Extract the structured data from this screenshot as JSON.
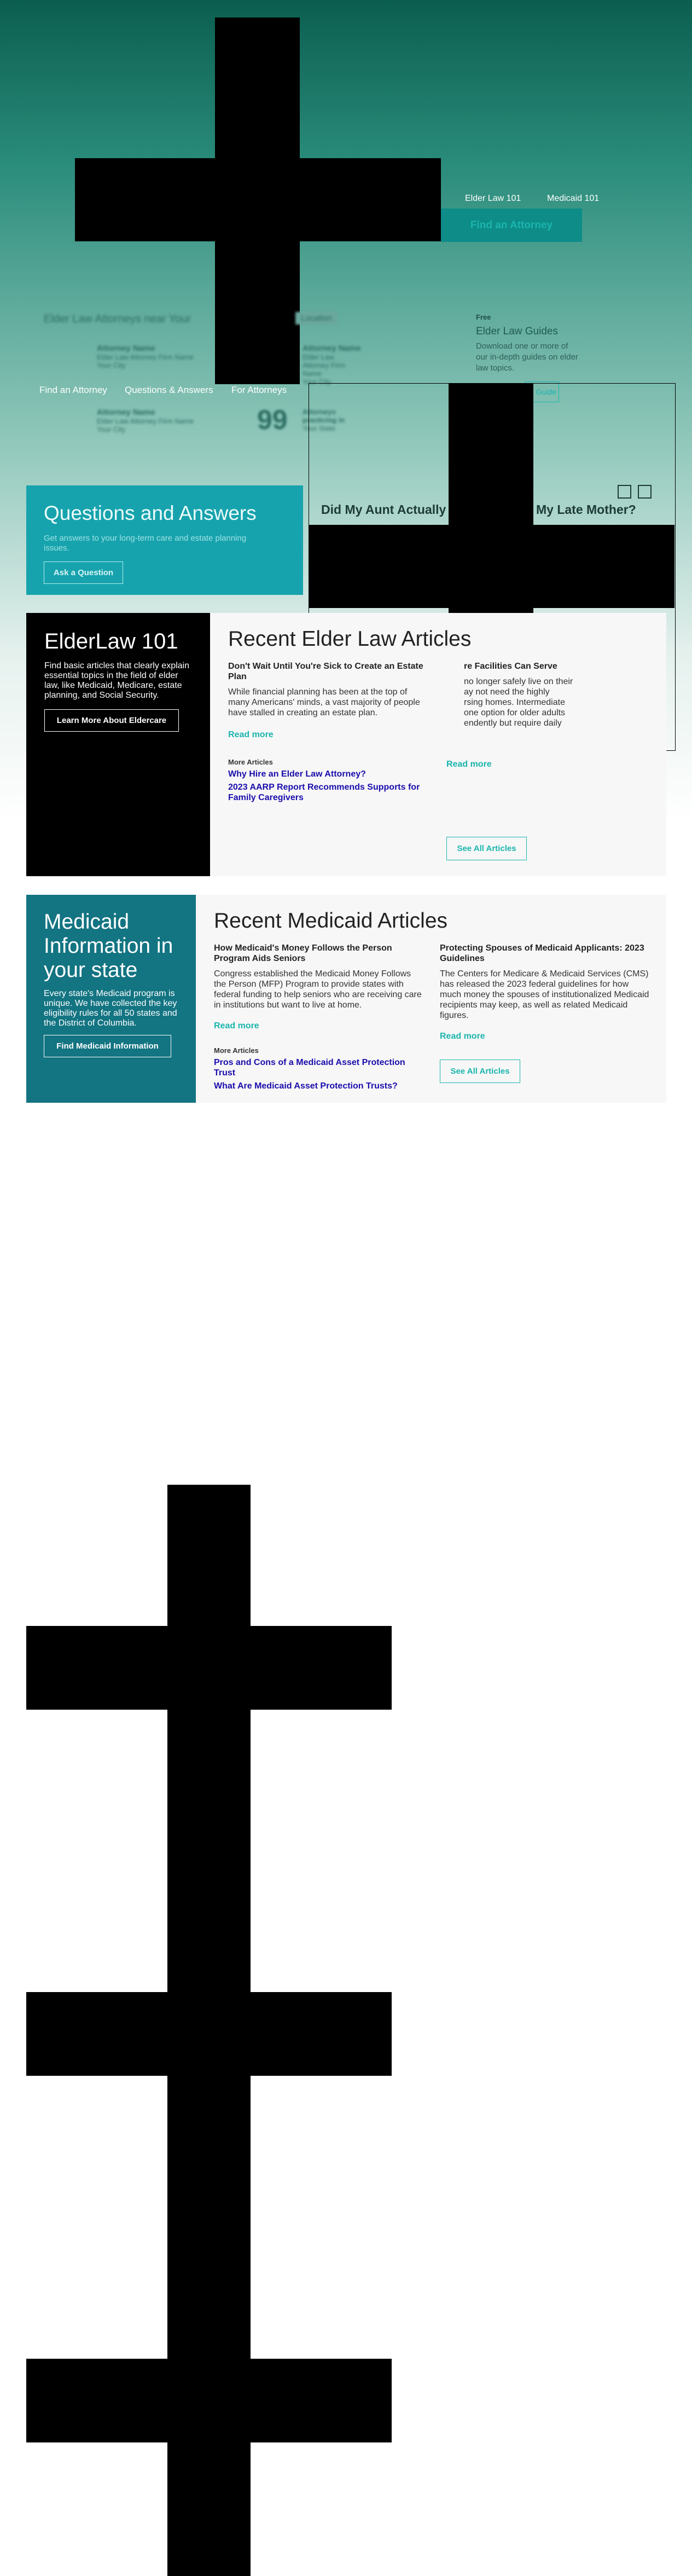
{
  "nav": {
    "elder_law_101": "Elder Law 101",
    "medicaid_101": "Medicaid 101",
    "find_attorney": "Find an Attorney"
  },
  "attorney_list": {
    "title": "Elder Law Attorneys near Your",
    "chip": "Location",
    "items": [
      {
        "name": "Attorney Name",
        "firm": "Elder Law Attorney Firm Name",
        "city": "Your City"
      },
      {
        "name": "Attorney Name",
        "firm": "Elder Law Attorney Firm Name",
        "city": "Your City"
      },
      {
        "name": "Attorney Name",
        "firm": "Elder Law Attorney Firm Name",
        "city": "Your City"
      }
    ],
    "count": "99",
    "count_label_1": "Attorneys practicing in",
    "count_label_2": "Your State"
  },
  "free_guides": {
    "label": "Free",
    "title": "Elder Law Guides",
    "desc_1": "Download one or more of",
    "desc_2": "our in-depth guides on elder",
    "desc_3": "law topics.",
    "button": "Guide"
  },
  "subnav": {
    "find_attorney": "Find an Attorney",
    "qa": "Questions & Answers",
    "for_attorneys": "For Attorneys"
  },
  "qa": {
    "title": "Questions and Answers",
    "desc": "Get answers to your long-term care and estate planning issues.",
    "button": "Ask a Question"
  },
  "slider": {
    "title_left": "Did My Aunt Actually H",
    "title_right": "My Late Mother?"
  },
  "elderlaw": {
    "title": "ElderLaw 101",
    "desc": "Find basic articles that clearly explain essential topics in the field of elder law, like Medicaid, Medicare, estate planning, and Social Security.",
    "button": "Learn More About Eldercare",
    "section_title": "Recent Elder Law Articles",
    "article1": {
      "title": "Don't Wait Until You're Sick to Create an Estate Plan",
      "body": "While financial planning has been at the top of many Americans' minds, a vast majority of people have stalled in creating an estate plan.",
      "read_more": "Read more"
    },
    "article2": {
      "title_frag": "re Facilities Can Serve",
      "body_1": "no longer safely live on their",
      "body_2": "ay not need the highly",
      "body_3": "rsing homes. Intermediate",
      "body_4": "one option for older adults",
      "body_5": "endently but require daily",
      "read_more": "Read more"
    },
    "more_label": "More Articles",
    "more_links": [
      "Why Hire an Elder Law Attorney?",
      "2023 AARP Report Recommends Supports for Family Caregivers"
    ],
    "see_all": "See All Articles"
  },
  "medicaid": {
    "title": "Medicaid Information in your state",
    "desc": "Every state's Medicaid program is unique. We have collected the key eligibility rules for all 50 states and the District of Columbia.",
    "button": "Find Medicaid Information",
    "section_title": "Recent Medicaid Articles",
    "article1": {
      "title": "How Medicaid's Money Follows the Person Program Aids Seniors",
      "body": "Congress established the Medicaid Money Follows the Person (MFP) Program to provide states with federal funding to help seniors who are receiving care in institutions but want to live at home.",
      "read_more": "Read more"
    },
    "article2": {
      "title": "Protecting Spouses of Medicaid Applicants: 2023 Guidelines",
      "body": "The Centers for Medicare & Medicaid Services (CMS) has released the 2023 federal guidelines for how much money the spouses of institutionalized Medicaid recipients may keep, as well as related Medicaid figures.",
      "read_more": "Read more"
    },
    "more_label": "More Articles",
    "more_links": [
      "Pros and Cons of a Medicaid Asset Protection Trust",
      "What Are Medicaid Asset Protection Trusts?"
    ],
    "see_all": "See All Articles"
  }
}
